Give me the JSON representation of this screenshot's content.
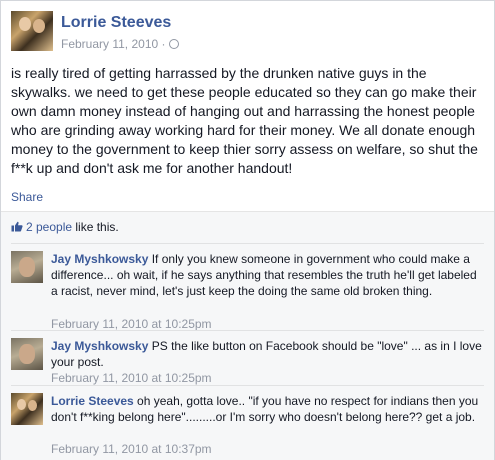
{
  "post": {
    "author": "Lorrie Steeves",
    "date": "February 11, 2010 ·",
    "text": "is really tired of getting harrassed by the drunken native guys in the skywalks. we need to get these people educated so they can go make their own damn money instead of hanging out and harrassing the honest people who are grinding away working hard for their money. We all donate enough money to the government to keep thier sorry assess on welfare, so shut the f**k up and don't ask me for another handout!",
    "share_label": "Share",
    "privacy_icon": "globe-icon"
  },
  "likes": {
    "icon": "thumbs-up-icon",
    "count_label": "2 people",
    "suffix": " like this."
  },
  "comments": [
    {
      "author": "Jay Myshkowsky",
      "text": " If only you knew someone in government who could make a difference... oh wait, if he says anything that resembles the truth he'll get labeled a racist, never mind, let's just keep the doing the same old broken thing.",
      "time": "February 11, 2010 at 10:25pm"
    },
    {
      "author": "Jay Myshkowsky",
      "text": " PS the like button on Facebook should be \"love\" ... as in I love your post.",
      "time": "February 11, 2010 at 10:25pm"
    },
    {
      "author": "Lorrie Steeves",
      "text": " oh yeah, gotta love.. \"if you have no respect for indians then you don't f**king belong here\".........or I'm sorry who doesn't belong here?? get a job.",
      "time": "February 11, 2010 at 10:37pm"
    }
  ],
  "colors": {
    "link_blue": "#3b5998",
    "meta_gray": "#9197a3",
    "comments_bg": "#f6f7f8"
  }
}
